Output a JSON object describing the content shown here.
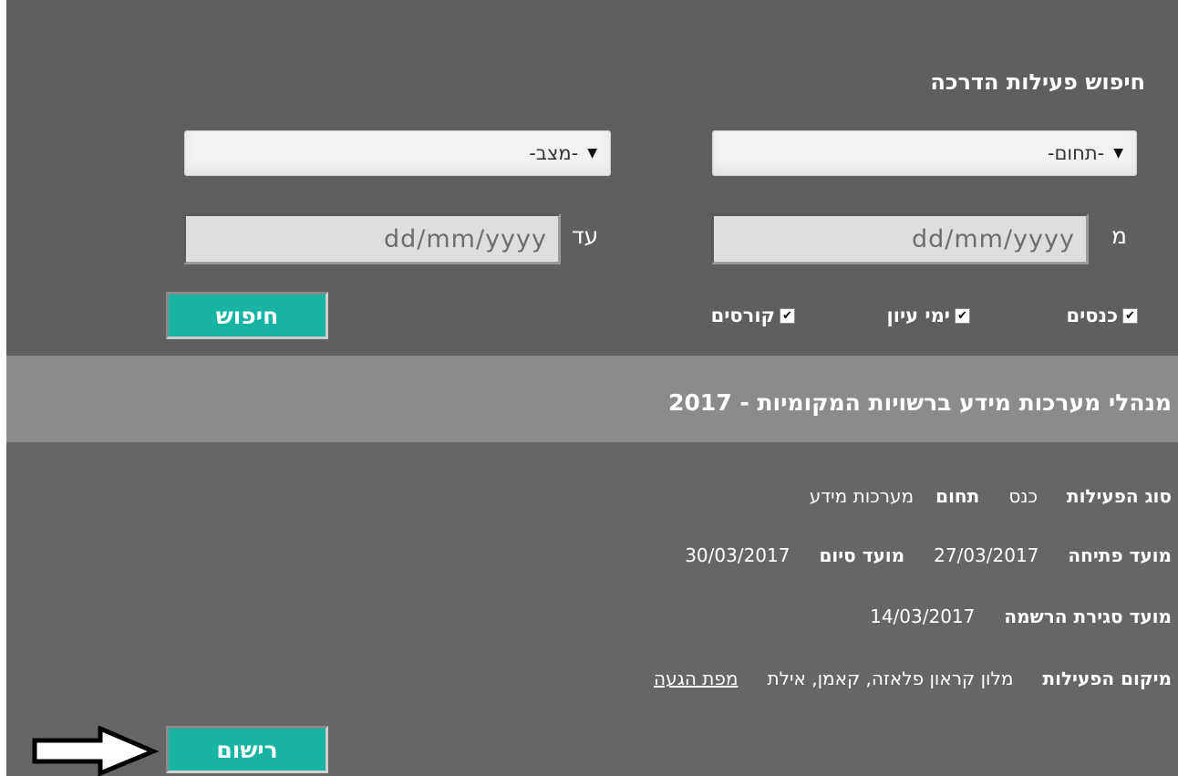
{
  "search": {
    "title": "חיפוש פעילות הדרכה",
    "domain_select": "-תחום-",
    "status_select": "-מצב-",
    "from_label": "מ",
    "to_label": "עד",
    "date_placeholder_from": "dd/mm/yyyy",
    "date_placeholder_to": "dd/mm/yyyy",
    "checkboxes": [
      {
        "label": "כנסים",
        "checked": true
      },
      {
        "label": "ימי עיון",
        "checked": true
      },
      {
        "label": "קורסים",
        "checked": true
      }
    ],
    "search_button": "חיפוש"
  },
  "activity": {
    "title": "מנהלי מערכות מידע ברשויות המקומיות - 2017",
    "type_label": "סוג הפעילות",
    "type_value": "כנס",
    "domain_label": "תחום",
    "domain_value": "מערכות מידע",
    "open_label": "מועד פתיחה",
    "open_value": "27/03/2017",
    "end_label": "מועד סיום",
    "end_value": "30/03/2017",
    "reg_close_label": "מועד סגירת הרשמה",
    "reg_close_value": "14/03/2017",
    "location_label": "מיקום הפעילות",
    "location_value": "מלון קראון פלאזה, קאמן, אילת",
    "map_link": "מפת הגעה",
    "register_button": "רישום"
  },
  "colors": {
    "top_bg": "#5f5f5f",
    "band_bg": "#8b8b8b",
    "body_bg": "#666666",
    "button": "#17b3a3"
  }
}
